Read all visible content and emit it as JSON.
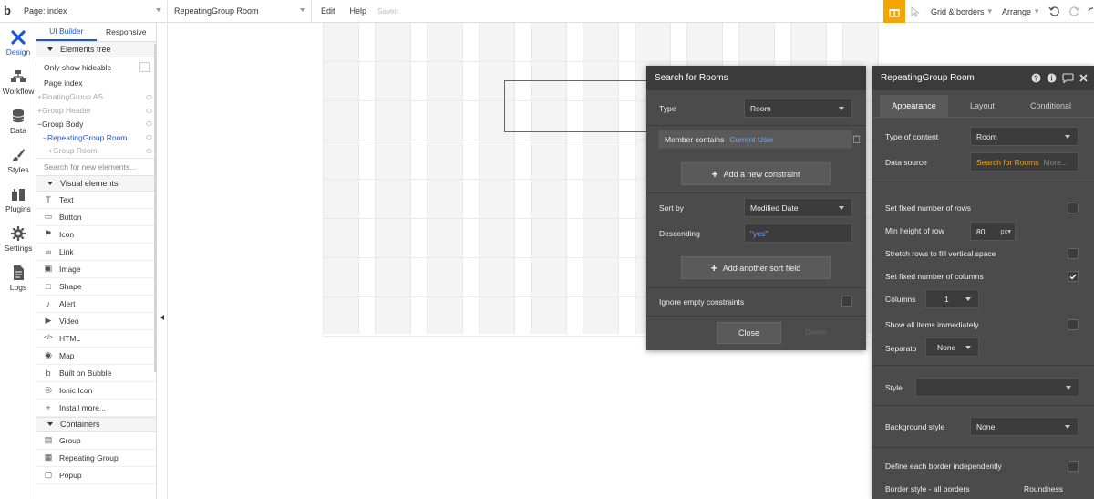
{
  "topbar": {
    "page_label": "Page: index",
    "element_label": "RepeatingGroup Room",
    "menu": [
      "Edit",
      "Help"
    ],
    "saved": "Saved",
    "grid": "Grid & borders",
    "arrange": "Arrange"
  },
  "rail": [
    {
      "label": "Design",
      "icon": "design-icon"
    },
    {
      "label": "Workflow",
      "icon": "workflow-icon"
    },
    {
      "label": "Data",
      "icon": "data-icon"
    },
    {
      "label": "Styles",
      "icon": "styles-icon"
    },
    {
      "label": "Plugins",
      "icon": "plugins-icon"
    },
    {
      "label": "Settings",
      "icon": "settings-icon"
    },
    {
      "label": "Logs",
      "icon": "logs-icon"
    }
  ],
  "lpanel": {
    "tabs": [
      "UI Builder",
      "Responsive"
    ],
    "elements_tree": "Elements tree",
    "only_show_hideable": "Only show hideable",
    "tree": [
      {
        "label": "Page index",
        "style": ""
      },
      {
        "label": "+FloatingGroup AS",
        "style": "muted"
      },
      {
        "label": "+Group Header",
        "style": "muted"
      },
      {
        "label": "−Group Body",
        "style": ""
      },
      {
        "label": "−RepeatingGroup Room",
        "style": "blue"
      },
      {
        "label": "+Group Room",
        "style": "muted"
      }
    ],
    "search_placeholder": "Search for new elements...",
    "visual_elements": "Visual elements",
    "elements": [
      {
        "label": "Text",
        "glyph": "T"
      },
      {
        "label": "Button",
        "glyph": "▭"
      },
      {
        "label": "Icon",
        "glyph": "⚑"
      },
      {
        "label": "Link",
        "glyph": "∞"
      },
      {
        "label": "Image",
        "glyph": "▣"
      },
      {
        "label": "Shape",
        "glyph": "□"
      },
      {
        "label": "Alert",
        "glyph": "♪"
      },
      {
        "label": "Video",
        "glyph": "▶"
      },
      {
        "label": "HTML",
        "glyph": "</>"
      },
      {
        "label": "Map",
        "glyph": "◉"
      },
      {
        "label": "Built on Bubble",
        "glyph": "b"
      },
      {
        "label": "Ionic Icon",
        "glyph": "◎"
      },
      {
        "label": "Install more...",
        "glyph": "+"
      }
    ],
    "containers": "Containers",
    "container_items": [
      {
        "label": "Group",
        "glyph": "▤"
      },
      {
        "label": "Repeating Group",
        "glyph": "▦"
      },
      {
        "label": "Popup",
        "glyph": "▢"
      }
    ]
  },
  "search_dialog": {
    "title": "Search for Rooms",
    "type_label": "Type",
    "type_value": "Room",
    "constraint_label": "Member contains",
    "constraint_value": "Current User",
    "add_constraint": "Add a new constraint",
    "sort_label": "Sort by",
    "sort_value": "Modified Date",
    "desc_label": "Descending",
    "desc_value": "\"yes\"",
    "add_sort": "Add another sort field",
    "ignore_label": "Ignore empty constraints",
    "close": "Close",
    "delete": "Delete"
  },
  "props": {
    "title": "RepeatingGroup Room",
    "tabs": [
      "Appearance",
      "Layout",
      "Conditional"
    ],
    "type_label": "Type of content",
    "type_value": "Room",
    "ds_label": "Data source",
    "ds_value": "Search for Rooms",
    "ds_more": "More...",
    "fixed_rows": "Set fixed number of rows",
    "min_height": "Min height of row",
    "min_height_value": "80",
    "min_height_unit": "px",
    "stretch": "Stretch rows to fill vertical space",
    "fixed_cols": "Set fixed number of columns",
    "columns_label": "Columns",
    "columns_value": "1",
    "show_all": "Show all items immediately",
    "separator_label": "Separato",
    "separator_value": "None",
    "style_label": "Style",
    "style_value": "",
    "bg_label": "Background style",
    "bg_value": "None",
    "border_ind": "Define each border independently",
    "border_style": "Border style - all borders",
    "roundness": "Roundness"
  },
  "colors": {
    "accent": "#1b56d8",
    "gift": "#f6a500",
    "dialog_bg": "#4b4b4b",
    "data_source": "#f6a500",
    "link_blue": "#6ea8ff"
  }
}
